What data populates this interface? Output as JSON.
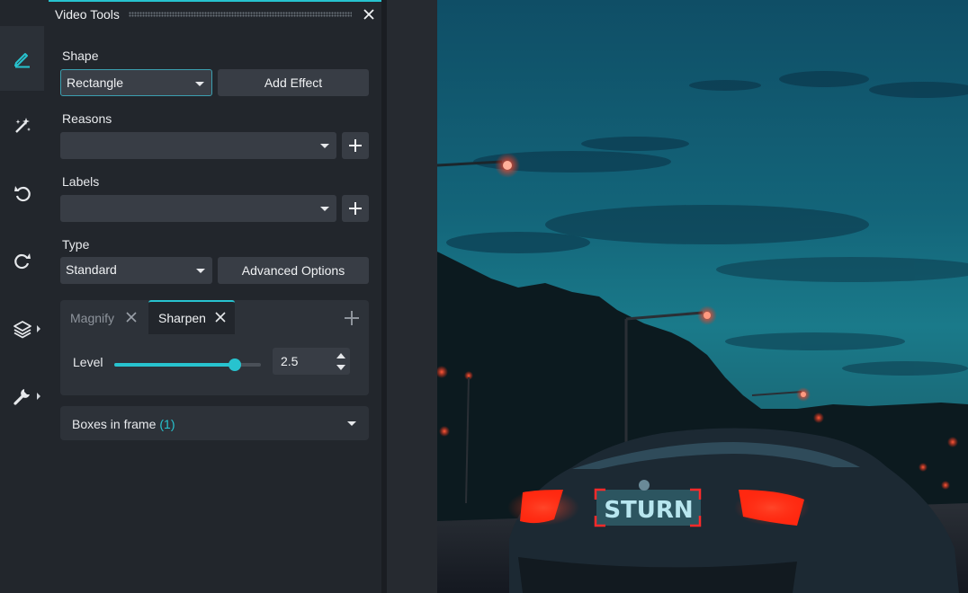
{
  "panel": {
    "title": "Video Tools"
  },
  "rail": {
    "items": [
      {
        "name": "pencil-icon",
        "active": true
      },
      {
        "name": "magic-wand-icon",
        "active": false
      },
      {
        "name": "undo-icon",
        "active": false
      },
      {
        "name": "redo-icon",
        "active": false
      },
      {
        "name": "layers-icon",
        "active": false
      },
      {
        "name": "wrench-icon",
        "active": false
      }
    ]
  },
  "shape": {
    "label": "Shape",
    "value": "Rectangle",
    "add_effect_label": "Add Effect"
  },
  "reasons": {
    "label": "Reasons",
    "value": ""
  },
  "labels": {
    "label": "Labels",
    "value": ""
  },
  "type": {
    "label": "Type",
    "value": "Standard",
    "advanced_label": "Advanced Options"
  },
  "effects": {
    "tabs": [
      {
        "label": "Magnify",
        "active": false
      },
      {
        "label": "Sharpen",
        "active": true
      }
    ],
    "level": {
      "label": "Level",
      "value": "2.5",
      "fraction": 0.82
    }
  },
  "boxes": {
    "label": "Boxes in frame",
    "count": "(1)"
  },
  "video": {
    "plate_text": "STURN"
  },
  "colors": {
    "accent": "#27c3cf",
    "panel": "#22262c",
    "control": "#383d45",
    "annotation_box": "#ff2a2a"
  }
}
